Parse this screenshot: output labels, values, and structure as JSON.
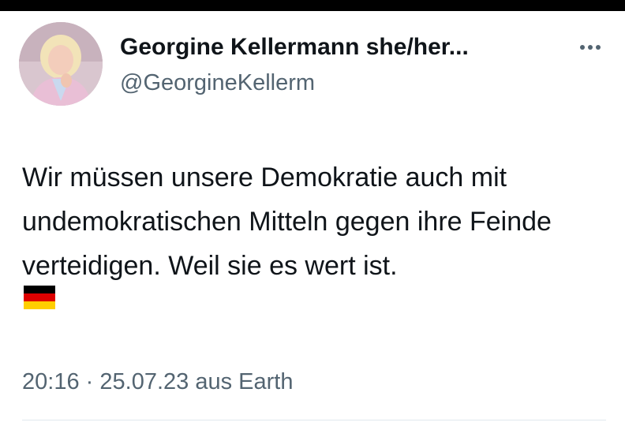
{
  "post": {
    "author": {
      "display_name": "Georgine Kellermann she/her...",
      "handle": "@GeorgineKellerm",
      "avatar_icon": "profile-photo"
    },
    "more_icon": "more-horizontal-icon",
    "text": "Wir müssen unsere Demokratie auch mit undemokratischen Mitteln gegen ihre Feinde verteidigen. Weil sie es wert ist.",
    "flag_icon": "german-flag-emoji",
    "meta": {
      "time": "20:16",
      "separator": "·",
      "date": "25.07.23",
      "source": "aus Earth"
    }
  },
  "colors": {
    "text_primary": "#0f1419",
    "text_secondary": "#536471",
    "top_bar": "#000000"
  }
}
